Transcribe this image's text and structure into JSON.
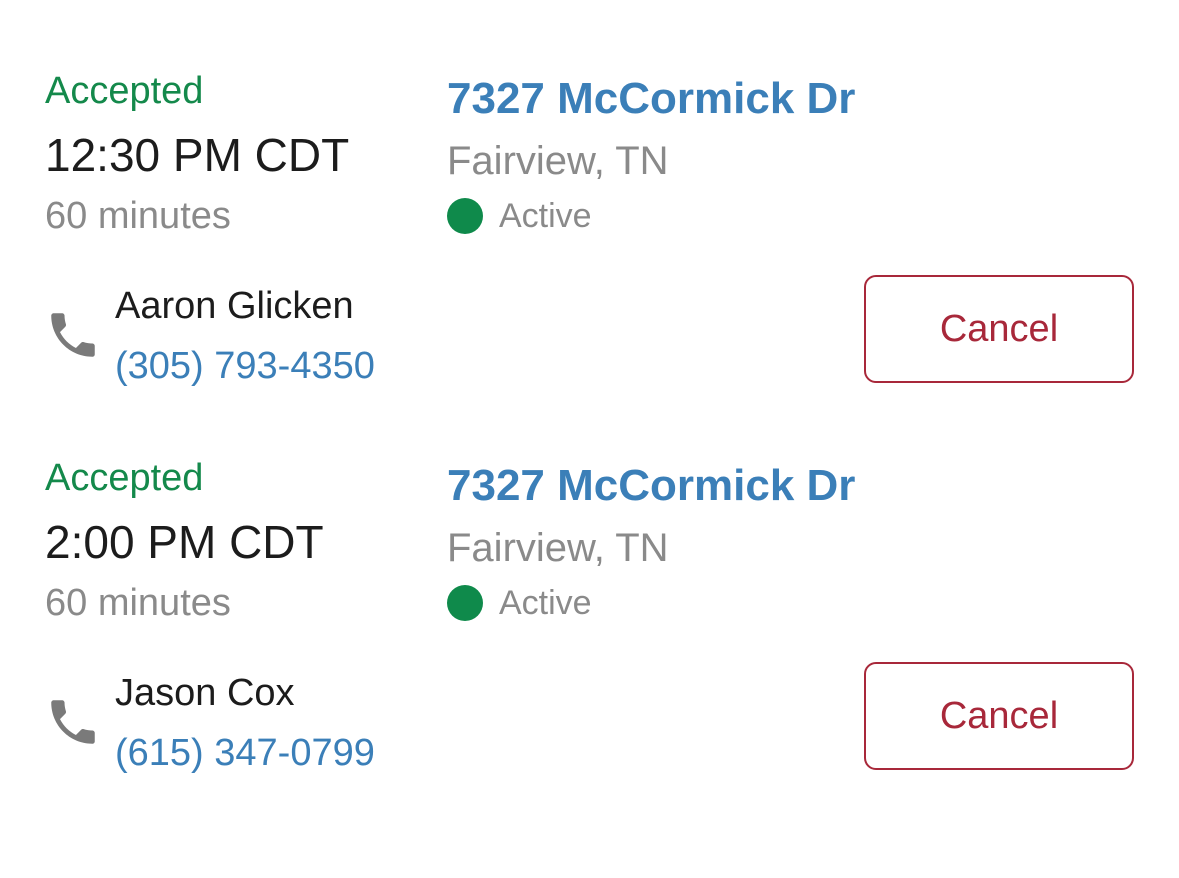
{
  "appointments": [
    {
      "status": "Accepted",
      "time": "12:30 PM CDT",
      "duration": "60 minutes",
      "address": "7327 McCormick Dr",
      "city": "Fairview, TN",
      "property_status": "Active",
      "contact_name": "Aaron Glicken",
      "contact_phone": "(305) 793-4350",
      "cancel_label": "Cancel"
    },
    {
      "status": "Accepted",
      "time": "2:00 PM CDT",
      "duration": "60 minutes",
      "address": "7327 McCormick Dr",
      "city": "Fairview, TN",
      "property_status": "Active",
      "contact_name": "Jason Cox",
      "contact_phone": "(615) 347-0799",
      "cancel_label": "Cancel"
    }
  ],
  "colors": {
    "accepted": "#14894b",
    "link": "#3b7fb8",
    "muted": "#8a8a8a",
    "active_dot": "#0f8a4b",
    "cancel": "#a8283a"
  },
  "icons": {
    "phone": "phone-icon",
    "status_dot": "active-status-dot"
  }
}
